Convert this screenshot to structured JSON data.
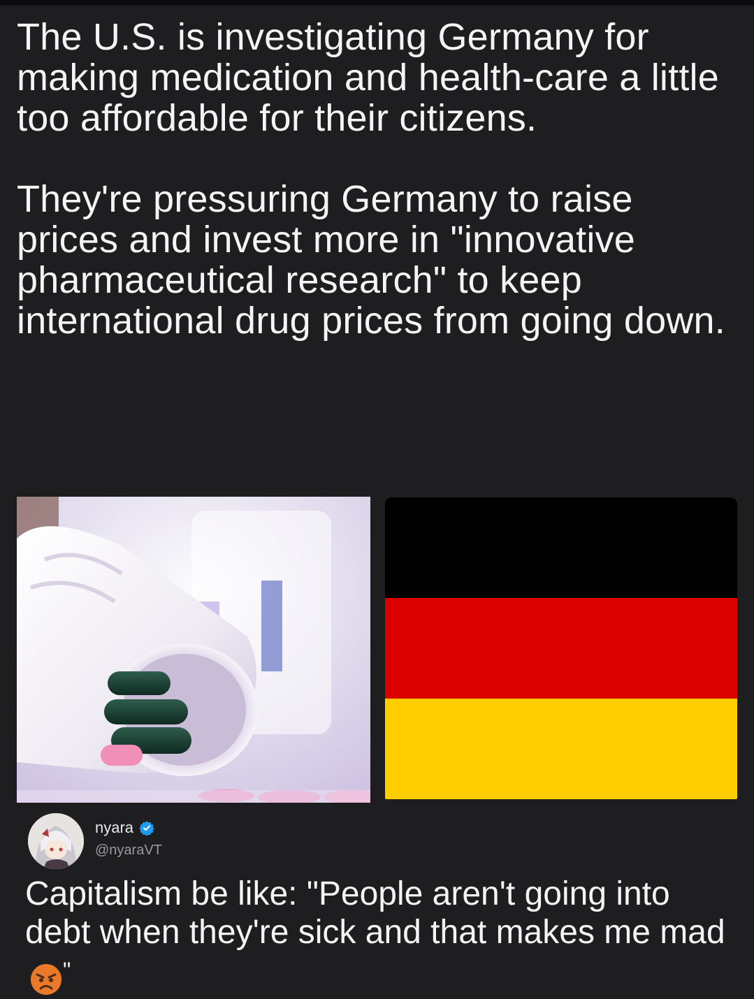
{
  "headline": {
    "paragraph1": "The U.S. is investigating Germany for making medication and health-care a little too affordable for their citizens.",
    "paragraph2": "They're pressuring Germany to raise prices and invest more in \"innovative pharmaceutical research\" to keep international drug prices from going down."
  },
  "images": {
    "left": "pill-bottle-photo",
    "right": "german-flag",
    "flag_colors": [
      "#000000",
      "#dd0000",
      "#ffce00"
    ]
  },
  "tweet": {
    "name": "nyara",
    "handle": "@nyaraVT",
    "verified_icon": "verified-badge-icon",
    "text": "Capitalism be like: \"People aren't going into debt when they're sick and that makes me mad",
    "emoji": "angry-face-icon",
    "closing_quote": "\""
  }
}
